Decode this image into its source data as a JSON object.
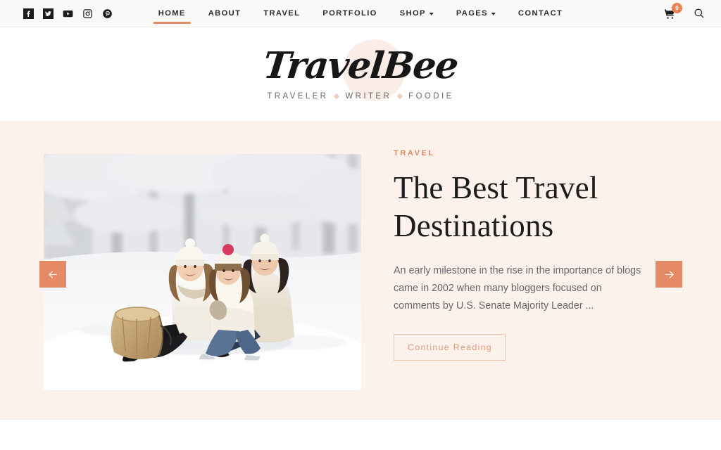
{
  "topbar": {
    "social": [
      {
        "name": "facebook-icon",
        "label": "Facebook"
      },
      {
        "name": "twitter-icon",
        "label": "Twitter"
      },
      {
        "name": "youtube-icon",
        "label": "YouTube"
      },
      {
        "name": "instagram-icon",
        "label": "Instagram"
      },
      {
        "name": "pinterest-icon",
        "label": "Pinterest"
      }
    ],
    "nav": [
      {
        "label": "HOME",
        "active": true,
        "caret": false
      },
      {
        "label": "ABOUT",
        "active": false,
        "caret": false
      },
      {
        "label": "TRAVEL",
        "active": false,
        "caret": false
      },
      {
        "label": "PORTFOLIO",
        "active": false,
        "caret": false
      },
      {
        "label": "SHOP",
        "active": false,
        "caret": true
      },
      {
        "label": "PAGES",
        "active": false,
        "caret": true
      },
      {
        "label": "CONTACT",
        "active": false,
        "caret": false
      }
    ],
    "cart_count": "0",
    "search_label": "Search"
  },
  "logo": {
    "name": "TravelBee",
    "tagline_words": [
      "TRAVELER",
      "WRITER",
      "FOODIE"
    ]
  },
  "hero": {
    "category": "TRAVEL",
    "title": "The Best Travel Destinations",
    "excerpt": "An early milestone in the rise in the importance of blogs came in 2002 when many bloggers focused on comments by U.S. Senate Majority Leader ...",
    "cta_label": "Continue Reading",
    "prev_label": "Previous slide",
    "next_label": "Next slide",
    "image_alt": "Three women in white winter coats and knit hats sitting in the snow with a wooden toboggan sled"
  },
  "colors": {
    "accent": "#e58a64",
    "accent_light": "#f1c6b3",
    "hero_bg": "#fdf1ec",
    "topbar_bg": "#faf9f7",
    "badge": "#ef7f52",
    "text_dark": "#1c1c1c",
    "text_muted": "#67676a"
  }
}
